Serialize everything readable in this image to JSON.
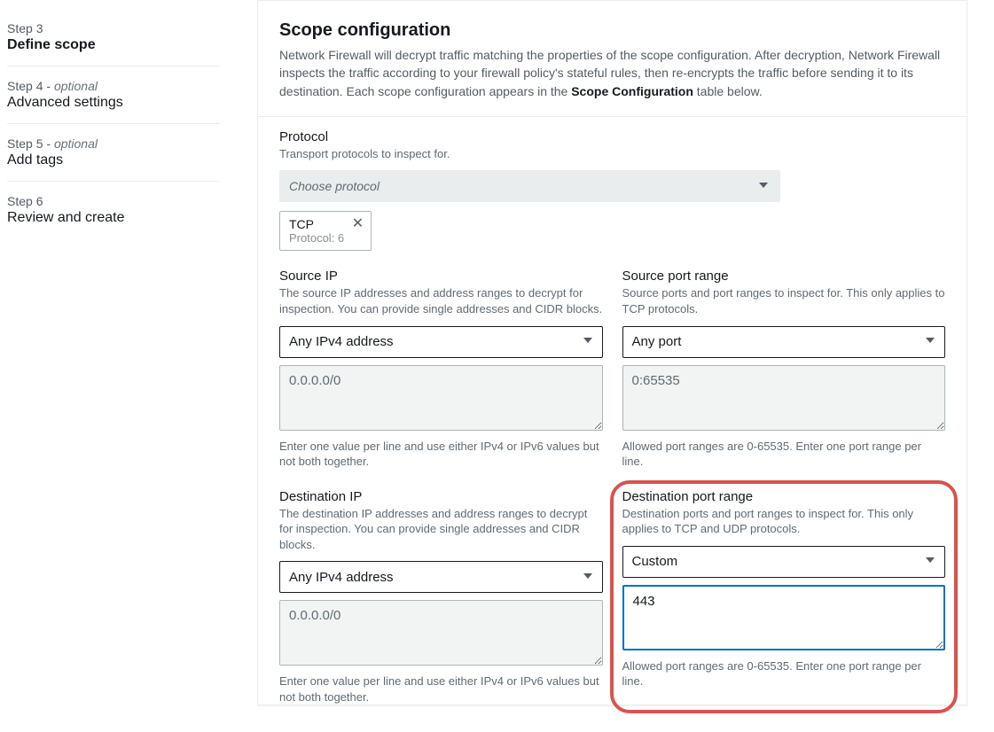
{
  "sidebar": {
    "steps": [
      {
        "header": "Step 3",
        "title": "Define scope",
        "active": true,
        "optional": false
      },
      {
        "header": "Step 4",
        "title": "Advanced settings",
        "active": false,
        "optional": true
      },
      {
        "header": "Step 5",
        "title": "Add tags",
        "active": false,
        "optional": true
      },
      {
        "header": "Step 6",
        "title": "Review and create",
        "active": false,
        "optional": false
      }
    ],
    "optional_label": "optional"
  },
  "scope": {
    "title": "Scope configuration",
    "desc_pre": "Network Firewall will decrypt traffic matching the properties of the scope configuration. After decryption, Network Firewall inspects the traffic according to your firewall policy's stateful rules, then re-encrypts the traffic before sending it to its destination. Each scope configuration appears in the ",
    "desc_bold": "Scope Configuration",
    "desc_post": " table below."
  },
  "protocol": {
    "label": "Protocol",
    "help": "Transport protocols to inspect for.",
    "placeholder": "Choose protocol",
    "tag_title": "TCP",
    "tag_sub": "Protocol: 6"
  },
  "sourceIP": {
    "label": "Source IP",
    "help": "The source IP addresses and address ranges to decrypt for inspection. You can provide single addresses and CIDR blocks.",
    "select": "Any IPv4 address",
    "textarea": "0.0.0.0/0",
    "below": "Enter one value per line and use either IPv4 or IPv6 values but not both together."
  },
  "sourcePort": {
    "label": "Source port range",
    "help": "Source ports and port ranges to inspect for. This only applies to TCP protocols.",
    "select": "Any port",
    "textarea": "0:65535",
    "below": "Allowed port ranges are 0-65535. Enter one port range per line."
  },
  "destIP": {
    "label": "Destination IP",
    "help": "The destination IP addresses and address ranges to decrypt for inspection. You can provide single addresses and CIDR blocks.",
    "select": "Any IPv4 address",
    "textarea": "0.0.0.0/0",
    "below": "Enter one value per line and use either IPv4 or IPv6 values but not both together."
  },
  "destPort": {
    "label": "Destination port range",
    "help": "Destination ports and port ranges to inspect for. This only applies to TCP and UDP protocols.",
    "select": "Custom",
    "textarea": "443",
    "below": "Allowed port ranges are 0-65535. Enter one port range per line."
  }
}
